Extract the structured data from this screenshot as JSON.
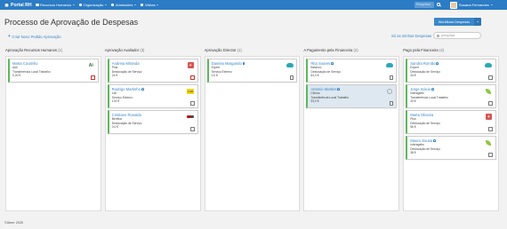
{
  "topbar": {
    "brand": "Portal RH",
    "nav": [
      {
        "label": "Recursos Humanos",
        "icon": "people-icon"
      },
      {
        "label": "Organização",
        "icon": "sitemap-icon"
      },
      {
        "label": "Admissões",
        "icon": "user-plus-icon"
      },
      {
        "label": "Visitas",
        "icon": "user-icon"
      }
    ],
    "search_placeholder": "Pesquisar",
    "user_name": "Susana Fernandes"
  },
  "page": {
    "title": "Processo de Aprovação de Despesas",
    "workflow_button": "Workflows Despesas",
    "new_request": "Criar Novo Pedido Aprovação",
    "my_requests": "Só as minhas Despesas",
    "filter_placeholder": "pesquisar"
  },
  "columns": [
    {
      "title": "Aprovação Recursos Humanos",
      "count": "(1)",
      "cards": [
        {
          "name": "Marta Coutinho",
          "bell": false,
          "lines": [
            "Aldi",
            "Transferência Local Trabalho",
            "0,00 €"
          ],
          "logo": "logo-a",
          "doc": "red"
        }
      ]
    },
    {
      "title": "Aprovação Avaliador",
      "count": "(3)",
      "cards": [
        {
          "name": "Andreia Miranda",
          "bell": false,
          "lines": [
            "Plus",
            "Deslocação de Serviço",
            "24 €"
          ],
          "logo": "logo-plus",
          "doc": "red"
        },
        {
          "name": "Rodrigo Martinho",
          "bell": true,
          "lines": [
            "Lidl",
            "Serviço Externo",
            "124 €"
          ],
          "logo": "logo-lidl",
          "doc": "gray"
        },
        {
          "name": "Cristiano Ronaldo",
          "bell": false,
          "lines": [
            "Benfica",
            "Deslocação de Serviço",
            "0,0 €"
          ],
          "logo": "logo-benfica",
          "doc": "gray"
        }
      ]
    },
    {
      "title": "Aprovação Director",
      "count": "(1)",
      "cards": [
        {
          "name": "Daniela Margarido",
          "bell": true,
          "lines": [
            "Expert",
            "Serviço Externo",
            "0,0 €"
          ],
          "logo": "logo-cloud",
          "doc": "gray"
        }
      ]
    },
    {
      "title": "A Pagamento pela Financeira",
      "count": "(2)",
      "cards": [
        {
          "name": "Rita Soares",
          "bell": true,
          "lines": [
            "Betanco",
            "Deslocação de Serviço",
            "64,0 €"
          ],
          "logo": "logo-cloud",
          "doc": "gray",
          "selected": false
        },
        {
          "name": "Antonio Martins",
          "bell": true,
          "lines": [
            "Clínica",
            "Transferência Local Trabalho",
            "33,0 €"
          ],
          "logo": "logo-circle",
          "doc": "gray",
          "selected": true
        }
      ]
    },
    {
      "title": "Pago pela Financeira",
      "count": "(4)",
      "cards": [
        {
          "name": "Sandra Romão",
          "bell": true,
          "lines": [
            "Expert",
            "Deslocação de Serviço",
            "34 €"
          ],
          "logo": "logo-cloud",
          "doc": "gray"
        },
        {
          "name": "Jorge Inácio",
          "bell": true,
          "lines": [
            "Interagebs",
            "Transferência Local Trabalho",
            "33 €"
          ],
          "logo": "logo-leaf",
          "doc": "gray"
        },
        {
          "name": "Marta Oliveira",
          "bell": false,
          "lines": [
            "Plus",
            "Deslocação de Serviço",
            "56 €"
          ],
          "logo": "logo-plus",
          "doc": "gray"
        },
        {
          "name": "Mauro Sousa",
          "bell": true,
          "lines": [
            "Interagebs",
            "Deslocação de Serviço",
            "38 €"
          ],
          "logo": "logo-leaf",
          "doc": "gray"
        }
      ]
    }
  ],
  "footer": "©Aleer 2020"
}
